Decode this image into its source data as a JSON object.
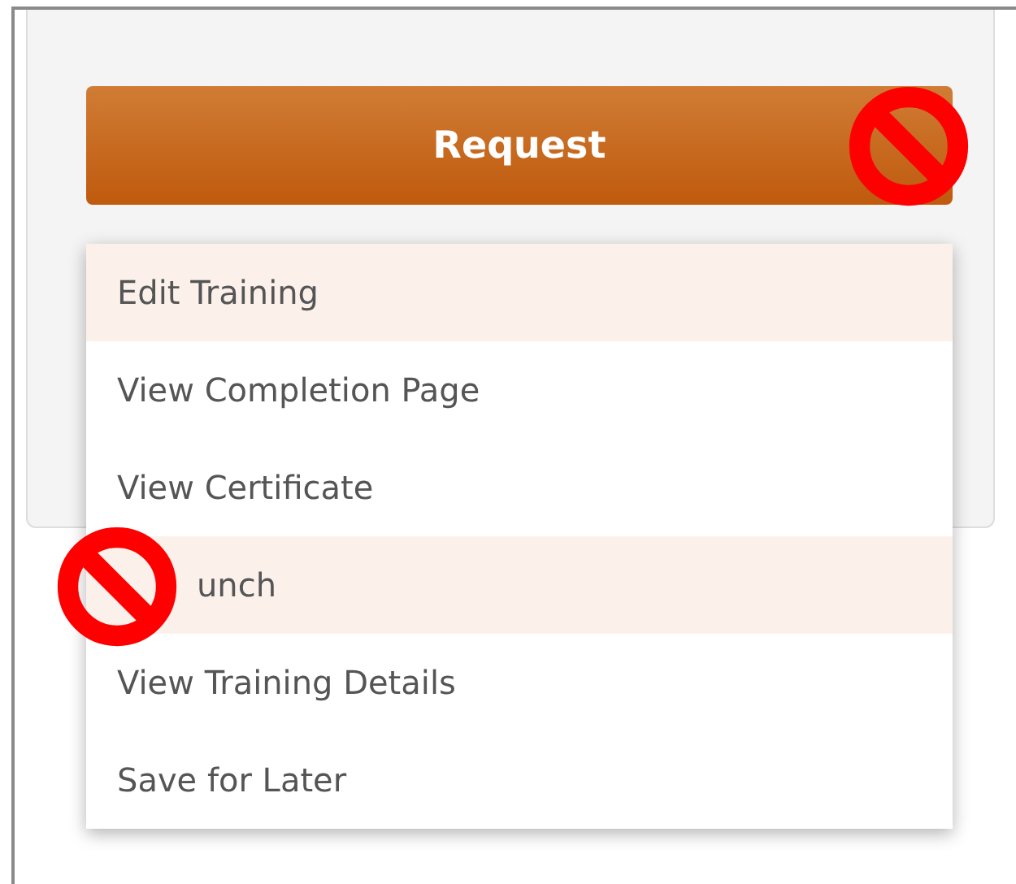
{
  "request_button": {
    "label": "Request"
  },
  "menu": {
    "items": [
      {
        "label": "Edit Training",
        "selected": true
      },
      {
        "label": "View Completion Page",
        "selected": false
      },
      {
        "label": "View Certificate",
        "selected": false
      },
      {
        "label": "unch",
        "selected": true,
        "kind": "covered"
      },
      {
        "label": "View Training Details",
        "selected": false
      },
      {
        "label": "Save for Later",
        "selected": false
      }
    ]
  }
}
